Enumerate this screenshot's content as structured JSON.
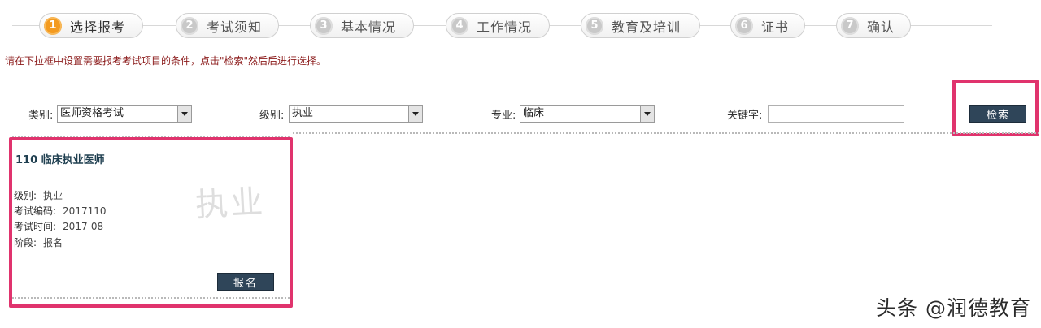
{
  "steps": [
    {
      "num": "1",
      "label": "选择报考"
    },
    {
      "num": "2",
      "label": "考试须知"
    },
    {
      "num": "3",
      "label": "基本情况"
    },
    {
      "num": "4",
      "label": "工作情况"
    },
    {
      "num": "5",
      "label": "教育及培训"
    },
    {
      "num": "6",
      "label": "证书"
    },
    {
      "num": "7",
      "label": "确认"
    }
  ],
  "instruction": "请在下拉框中设置需要报考考试项目的条件，点击\"检索\"然后后进行选择。",
  "filters": {
    "category_label": "类别:",
    "category_value": "医师资格考试",
    "level_label": "级别:",
    "level_value": "执业",
    "major_label": "专业:",
    "major_value": "临床",
    "keyword_label": "关键字:",
    "keyword_value": "",
    "search_button": "检索"
  },
  "result": {
    "title": "110 临床执业医师",
    "watermark": "执业",
    "rows": [
      {
        "label": "级别:",
        "value": "执业"
      },
      {
        "label": "考试编码:",
        "value": "2017110"
      },
      {
        "label": "考试时间:",
        "value": "2017-08"
      },
      {
        "label": "阶段:",
        "value": "报名"
      }
    ],
    "signup_button": "报名"
  },
  "brand_watermark": "头条 @润德教育",
  "colors": {
    "active_step": "#f39a1f",
    "highlight_frame": "#e0336d",
    "button_bg": "#2f4559",
    "instruction_text": "#8b1a1a"
  }
}
